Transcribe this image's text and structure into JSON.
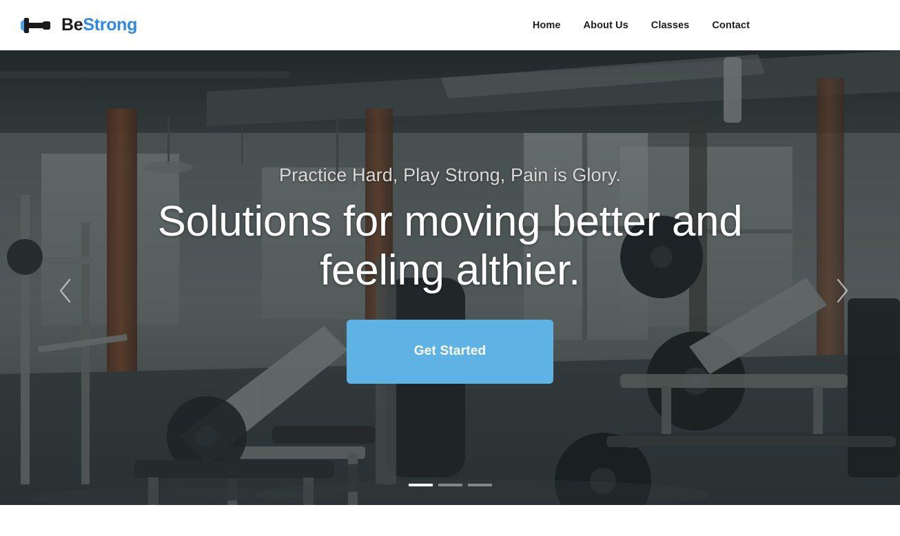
{
  "header": {
    "brand": {
      "icon": "dumbbell-icon",
      "text_primary": "Be",
      "text_accent": "Strong",
      "primary_color": "#1b1b1b",
      "accent_color": "#2f88e8"
    },
    "nav": [
      {
        "label": "Home"
      },
      {
        "label": "About Us"
      },
      {
        "label": "Classes"
      },
      {
        "label": "Contact"
      }
    ]
  },
  "hero": {
    "subtitle": "Practice Hard, Play Strong, Pain is Glory.",
    "title_line_1": "Solutions for moving better and",
    "title_line_2": "feeling althier.",
    "cta_label": "Get Started",
    "cta_color": "#5eb3e4",
    "background_description": "gym-interior-photo",
    "prev_icon": "chevron-left-icon",
    "next_icon": "chevron-right-icon",
    "slides": [
      {
        "active": true
      },
      {
        "active": false
      },
      {
        "active": false
      }
    ]
  }
}
